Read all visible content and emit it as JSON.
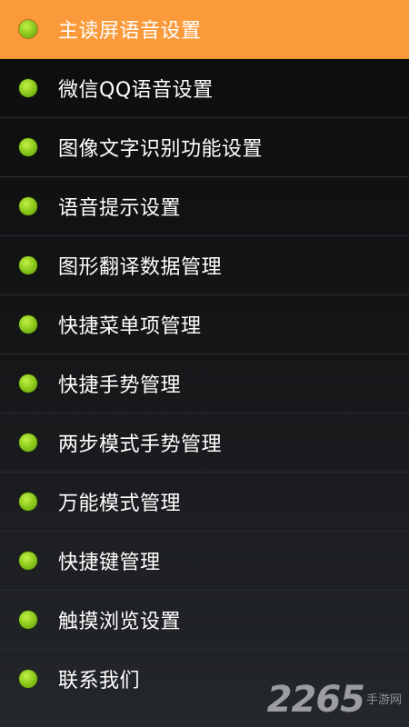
{
  "menu": {
    "items": [
      {
        "label": "主读屏语音设置",
        "selected": true
      },
      {
        "label": "微信QQ语音设置",
        "selected": false
      },
      {
        "label": "图像文字识别功能设置",
        "selected": false
      },
      {
        "label": "语音提示设置",
        "selected": false
      },
      {
        "label": "图形翻译数据管理",
        "selected": false
      },
      {
        "label": "快捷菜单项管理",
        "selected": false
      },
      {
        "label": "快捷手势管理",
        "selected": false
      },
      {
        "label": "两步模式手势管理",
        "selected": false
      },
      {
        "label": "万能模式管理",
        "selected": false
      },
      {
        "label": "快捷键管理",
        "selected": false
      },
      {
        "label": "触摸浏览设置",
        "selected": false
      },
      {
        "label": "联系我们",
        "selected": false
      }
    ]
  },
  "watermark": {
    "number": "2265",
    "suffix": "手游网"
  },
  "colors": {
    "selected_background": "#fb9a3a",
    "bullet": "#8fcd1e",
    "text": "#ffffff",
    "background": "#141517"
  },
  "icons": {
    "bullet": "green-dot-icon"
  }
}
